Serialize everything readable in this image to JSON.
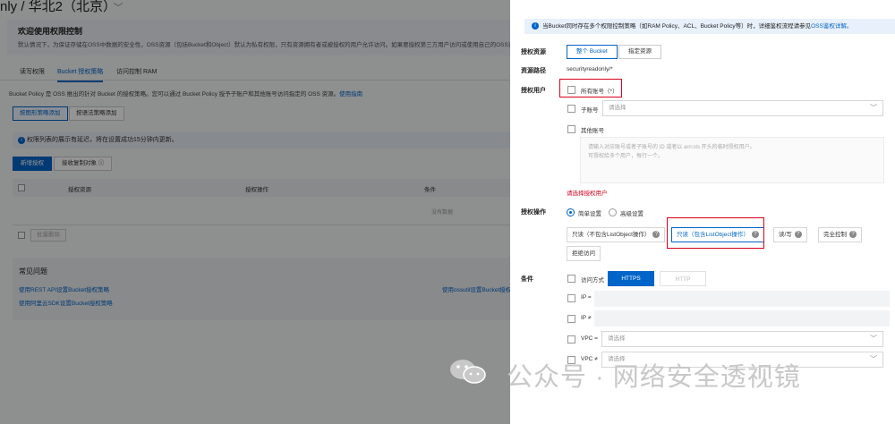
{
  "bg": {
    "title": "nly / 华北2（北京）",
    "title_chevron": "﹀",
    "card_title": "欢迎使用权限控制",
    "card_desc": "默认情况下，为保证存储在OSS中数据的安全性，OSS资源（包括Bucket和Object）默认为私有权限，只有资源拥有者或被授权的用户允许访问。如果要授权第三方用户访问或使用自己的OSS资",
    "tabs": [
      "读写权限",
      "Bucket 授权策略",
      "访问控制 RAM"
    ],
    "desc_text": "Bucket Policy 是 OSS 推出的针对 Bucket 的授权策略。您可以通过 Bucket Policy 授予子账户和其他账号访问指定的 OSS 资源。",
    "desc_link": "使用指南",
    "seg_buttons": [
      "按图形策略添加",
      "按语法策略添加"
    ],
    "info_text": "权限列表的展示有延迟，将在设置成功15分钟内更新。",
    "btn_add": "新增授权",
    "btn_receive": "接收复制对象 ⓘ",
    "table_headers": [
      "授权资源",
      "授权操作",
      "条件"
    ],
    "no_data": "没有数据",
    "batch_delete": "批量删除",
    "faq_title": "常见问题",
    "faq_links": [
      "使用REST API设置Bucket授权策略",
      "使用阿里云SDK设置Bucket授权策略",
      "使用ossutil设置Bucket授权"
    ]
  },
  "drawer": {
    "notice_text": "当Bucket同时存在多个权限控制策略（如RAM Policy、ACL、Bucket Policy等）时，详细鉴权流程请参见",
    "notice_link": "OSS鉴权详解。",
    "labels": {
      "resource": "授权资源",
      "path": "资源路径",
      "users": "授权用户",
      "ops": "授权操作",
      "cond": "条件"
    },
    "resource_options": [
      "整个 Bucket",
      "指定资源"
    ],
    "path_value": "securityreadonly/*",
    "user_all": "所有账号（*）",
    "user_sub": "子账号",
    "user_sub_placeholder": "请选择",
    "user_other": "其他账号",
    "other_placeholder_1": "请输入对应账号或者子账号的 ID 或者以 arn:sts 开头的临时授权用户。",
    "other_placeholder_2": "可授权给多个用户，每行一个。",
    "error_text": "请选择授权用户",
    "op_modes": [
      "简单设置",
      "高级设置"
    ],
    "op_buttons": [
      "只读（不包含ListObject操作）",
      "只读（包含ListObject操作）",
      "读/写",
      "完全控制",
      "拒绝访问"
    ],
    "cond_access": "访问方式",
    "cond_protocols": [
      "HTTPS",
      "HTTP"
    ],
    "cond_ip_eq": "IP =",
    "cond_ip_ne": "IP ≠",
    "cond_vpc_eq": "VPC =",
    "cond_vpc_ne": "VPC ≠",
    "select_placeholder": "请选择",
    "help_glyph": "?",
    "info_glyph": "i",
    "caret_glyph": "﹀"
  },
  "watermark": "公众号 · 网络安全透视镜",
  "colors": {
    "primary": "#0064c8",
    "danger": "#d9001b",
    "mask": "rgba(0,0,0,0.42)"
  }
}
